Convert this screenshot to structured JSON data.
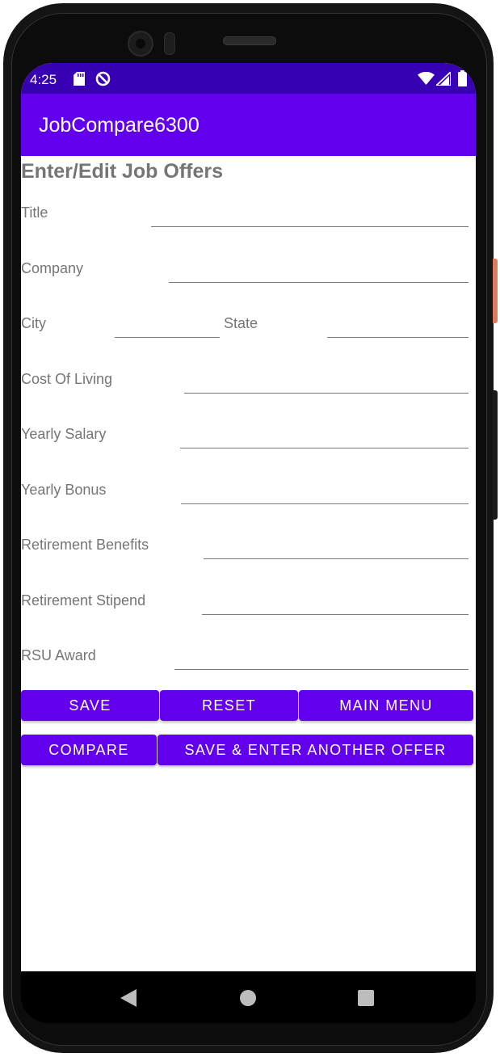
{
  "status_bar": {
    "time": "4:25",
    "left_icons": [
      "sd-card-icon",
      "data-saver-icon"
    ],
    "right_icons": [
      "wifi-icon",
      "cell-signal-icon",
      "battery-icon"
    ]
  },
  "app_bar": {
    "title": "JobCompare6300"
  },
  "form": {
    "heading": "Enter/Edit Job Offers",
    "fields": {
      "title": {
        "label": "Title",
        "value": ""
      },
      "company": {
        "label": "Company",
        "value": ""
      },
      "city": {
        "label": "City",
        "value": ""
      },
      "state": {
        "label": "State",
        "value": ""
      },
      "cost_of_living": {
        "label": "Cost Of Living",
        "value": ""
      },
      "yearly_salary": {
        "label": "Yearly Salary",
        "value": ""
      },
      "yearly_bonus": {
        "label": "Yearly Bonus",
        "value": ""
      },
      "retirement_benefits": {
        "label": "Retirement Benefits",
        "value": ""
      },
      "retirement_stipend": {
        "label": "Retirement Stipend",
        "value": ""
      },
      "rsu_award": {
        "label": "RSU Award",
        "value": ""
      }
    }
  },
  "buttons": {
    "save": "SAVE",
    "reset": "RESET",
    "main_menu": "MAIN MENU",
    "compare": "COMPARE",
    "save_and_enter_another": "SAVE & ENTER ANOTHER OFFER"
  },
  "nav_bar": {
    "icons": [
      "back-icon",
      "home-icon",
      "recents-icon"
    ]
  },
  "colors": {
    "status_bar": "#3700b3",
    "app_bar": "#6200ee",
    "button": "#6200ee",
    "label_text": "#757575",
    "frame": "#141414"
  }
}
